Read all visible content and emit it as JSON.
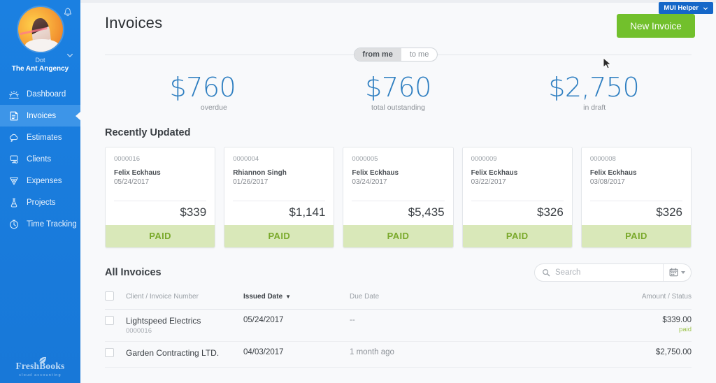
{
  "browser": {
    "extension_badge": {
      "label": "MUI Helper",
      "icon": "chevron-down-icon",
      "bg": "#1567c8"
    }
  },
  "sidebar": {
    "brand_color": "#1a7fe0",
    "avatar_icon": "user-avatar",
    "notifications_icon": "bell-icon",
    "account_caret_icon": "chevron-down-icon",
    "user_name": "Dot",
    "org_name": "The Ant Angency",
    "items": [
      {
        "label": "Dashboard",
        "icon": "dashboard-sun-icon",
        "active": false
      },
      {
        "label": "Invoices",
        "icon": "invoice-doc-icon",
        "active": true
      },
      {
        "label": "Estimates",
        "icon": "estimate-cloud-icon",
        "active": false
      },
      {
        "label": "Clients",
        "icon": "clients-lamp-icon",
        "active": false
      },
      {
        "label": "Expenses",
        "icon": "expenses-shield-icon",
        "active": false
      },
      {
        "label": "Projects",
        "icon": "projects-flask-icon",
        "active": false
      },
      {
        "label": "Time Tracking",
        "icon": "clock-icon",
        "active": false
      }
    ],
    "logo": {
      "word": "FreshBooks",
      "tagline": "cloud accounting",
      "icon": "leaf-icon"
    }
  },
  "header": {
    "title": "Invoices",
    "new_invoice_label": "New Invoice",
    "new_invoice_color": "#72c02c"
  },
  "direction_toggle": {
    "options": [
      {
        "label": "from me",
        "active": true
      },
      {
        "label": "to me",
        "active": false
      }
    ]
  },
  "stats": [
    {
      "value": "$760",
      "label": "overdue"
    },
    {
      "value": "$760",
      "label": "total outstanding"
    },
    {
      "value": "$2,750",
      "label": "in draft"
    }
  ],
  "recently_updated": {
    "title": "Recently Updated",
    "cards": [
      {
        "number": "0000016",
        "client": "Felix Eckhaus",
        "date": "05/24/2017",
        "amount": "$339",
        "status": "PAID"
      },
      {
        "number": "0000004",
        "client": "Rhiannon Singh",
        "date": "01/26/2017",
        "amount": "$1,141",
        "status": "PAID"
      },
      {
        "number": "0000005",
        "client": "Felix Eckhaus",
        "date": "03/24/2017",
        "amount": "$5,435",
        "status": "PAID"
      },
      {
        "number": "0000009",
        "client": "Felix Eckhaus",
        "date": "03/22/2017",
        "amount": "$326",
        "status": "PAID"
      },
      {
        "number": "0000008",
        "client": "Felix Eckhaus",
        "date": "03/08/2017",
        "amount": "$326",
        "status": "PAID"
      }
    ]
  },
  "all_invoices": {
    "title": "All Invoices",
    "search": {
      "placeholder": "Search",
      "value": "",
      "icon": "search-icon"
    },
    "date_filter": {
      "icon": "calendar-icon",
      "caret": "chevron-down-icon"
    },
    "columns": {
      "select_all": "select-all-checkbox",
      "client": "Client / Invoice Number",
      "issued": "Issued Date",
      "issued_sort": "▼",
      "due": "Due Date",
      "amount": "Amount / Status"
    },
    "rows": [
      {
        "client": "Lightspeed Electrics",
        "number": "0000016",
        "issued": "05/24/2017",
        "due": "--",
        "amount": "$339.00",
        "status": "paid"
      },
      {
        "client": "Garden Contracting LTD.",
        "number": "",
        "issued": "04/03/2017",
        "due": "1 month ago",
        "amount": "$2,750.00",
        "status": ""
      }
    ]
  }
}
